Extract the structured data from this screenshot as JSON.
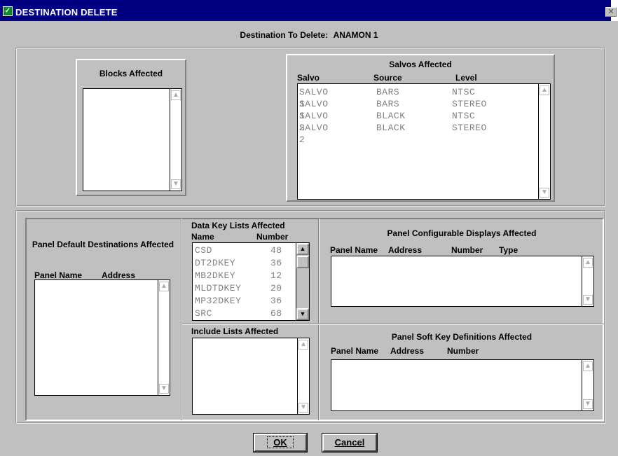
{
  "window": {
    "title": "DESTINATION DELETE",
    "app_icon": "check-icon",
    "close_glyph": "✕"
  },
  "header": {
    "label": "Destination To Delete:",
    "value": "ANAMON 1"
  },
  "blocks": {
    "title": "Blocks Affected",
    "items": []
  },
  "salvos": {
    "title": "Salvos  Affected",
    "columns": [
      "Salvo",
      "Source",
      "Level"
    ],
    "rows": [
      [
        "SALVO 1",
        "BARS",
        "NTSC"
      ],
      [
        "SALVO 1",
        "BARS",
        "STEREO"
      ],
      [
        "SALVO 2",
        "BLACK",
        "NTSC"
      ],
      [
        "SALVO 2",
        "BLACK",
        "STEREO"
      ]
    ]
  },
  "panel_default": {
    "title": "Panel Default Destinations Affected",
    "columns": [
      "Panel Name",
      "Address"
    ],
    "rows": []
  },
  "data_key_lists": {
    "title": "Data Key Lists Affected",
    "columns": [
      "Name",
      "Number"
    ],
    "rows": [
      [
        "CSD",
        "48"
      ],
      [
        "DT2DKEY",
        "36"
      ],
      [
        "MB2DKEY",
        "12"
      ],
      [
        "MLDTDKEY",
        "20"
      ],
      [
        "MP32DKEY",
        "36"
      ],
      [
        "SRC",
        "68"
      ]
    ]
  },
  "include_lists": {
    "title": "Include Lists Affected",
    "rows": []
  },
  "panel_configurable": {
    "title": "Panel Configurable Displays Affected",
    "columns": [
      "Panel Name",
      "Address",
      "Number",
      "Type"
    ],
    "rows": []
  },
  "panel_soft_keys": {
    "title": "Panel Soft Key Definitions Affected",
    "columns": [
      "Panel Name",
      "Address",
      "Number"
    ],
    "rows": []
  },
  "buttons": {
    "ok_label": "OK",
    "cancel_label": "Cancel"
  }
}
